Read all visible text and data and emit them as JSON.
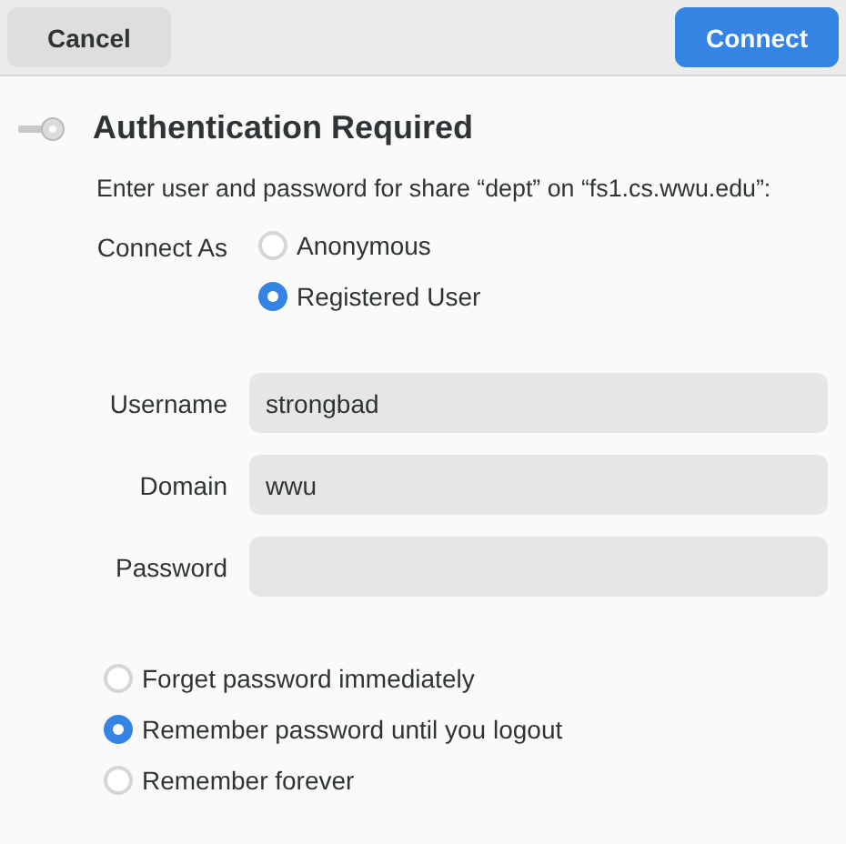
{
  "header": {
    "cancel": "Cancel",
    "connect": "Connect"
  },
  "title": "Authentication Required",
  "message": "Enter user and password for share “dept” on “fs1.cs.wwu.edu”:",
  "connect_as": {
    "label": "Connect As",
    "options": [
      {
        "label": "Anonymous",
        "selected": false
      },
      {
        "label": "Registered User",
        "selected": true
      }
    ]
  },
  "fields": [
    {
      "label": "Username",
      "value": "strongbad"
    },
    {
      "label": "Domain",
      "value": "wwu"
    },
    {
      "label": "Password"
    }
  ],
  "remember": [
    {
      "label": "Forget password immediately",
      "selected": false
    },
    {
      "label": "Remember password until you logout",
      "selected": true
    },
    {
      "label": "Remember forever",
      "selected": false
    }
  ]
}
